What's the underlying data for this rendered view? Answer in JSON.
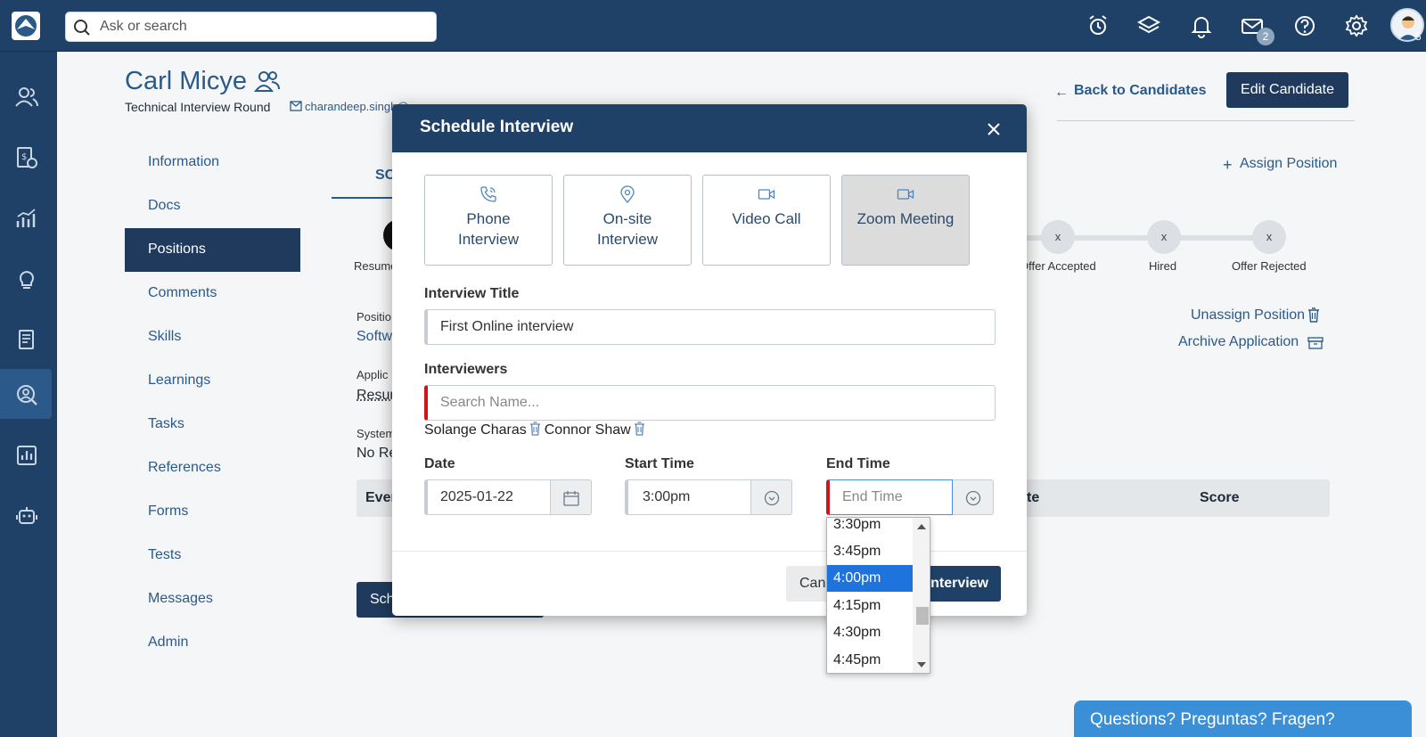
{
  "topbar": {
    "search_placeholder": "Ask or search",
    "mail_badge": "2",
    "avatar_badge": "5",
    "icons": [
      "alarm-clock-icon",
      "layers-icon",
      "bell-icon",
      "mail-icon",
      "help-icon",
      "gear-icon"
    ]
  },
  "rail": {
    "icons": [
      "users-icon",
      "billing-icon",
      "chart-icon",
      "lightbulb-icon",
      "documents-icon",
      "search-person-icon",
      "report-icon",
      "robot-icon"
    ],
    "active_index": 5
  },
  "candidate": {
    "name": "Carl Micye",
    "round": "Technical Interview Round",
    "email": "charandeep.singh@..."
  },
  "header_actions": {
    "back": "Back to Candidates",
    "edit": "Edit Candidate"
  },
  "side_nav": {
    "items": [
      "Information",
      "Docs",
      "Positions",
      "Comments",
      "Skills",
      "Learnings",
      "Tasks",
      "References",
      "Forms",
      "Tests",
      "Messages",
      "Admin"
    ],
    "active": "Positions"
  },
  "background": {
    "tab_partial": "SC",
    "assign_position": "Assign Position",
    "stage_left_label": "Resume",
    "stages": [
      {
        "mark": "x",
        "label": "Offer Accepted"
      },
      {
        "mark": "x",
        "label": "Hired"
      },
      {
        "mark": "x",
        "label": "Offer Rejected"
      }
    ],
    "unassign": "Unassign Position",
    "archive": "Archive Application",
    "frag_position": "Positio",
    "frag_software": "Softw",
    "frag_applic": "Applic",
    "frag_resume": "Resum",
    "frag_system": "System",
    "frag_nore": "No Re",
    "events_col1": "Even",
    "events_col2": "te",
    "events_col3": "Score",
    "schedule_btn_partial": "Sch"
  },
  "modal": {
    "title": "Schedule Interview",
    "types": [
      {
        "label_line1": "Phone",
        "label_line2": "Interview",
        "icon": "phone-icon",
        "selected": false
      },
      {
        "label_line1": "On-site",
        "label_line2": "Interview",
        "icon": "location-pin-icon",
        "selected": false
      },
      {
        "label_line1": "Video Call",
        "label_line2": "",
        "icon": "video-camera-icon",
        "selected": false
      },
      {
        "label_line1": "Zoom Meeting",
        "label_line2": "",
        "icon": "video-camera-icon",
        "selected": true
      }
    ],
    "interview_title_label": "Interview Title",
    "interview_title_value": "First Online interview",
    "interviewers_label": "Interviewers",
    "interviewers_placeholder": "Search Name...",
    "interviewers": [
      "Solange Charas",
      "Connor Shaw"
    ],
    "date_label": "Date",
    "date_value": "2025-01-22",
    "start_label": "Start Time",
    "start_value": "3:00pm",
    "end_label": "End Time",
    "end_placeholder": "End Time",
    "cancel": "Cancel",
    "submit": "Interview",
    "time_options": [
      "3:30pm",
      "3:45pm",
      "4:00pm",
      "4:15pm",
      "4:30pm",
      "4:45pm"
    ],
    "time_selected": "4:00pm"
  },
  "help_widget": "Questions? Preguntas? Fragen?"
}
